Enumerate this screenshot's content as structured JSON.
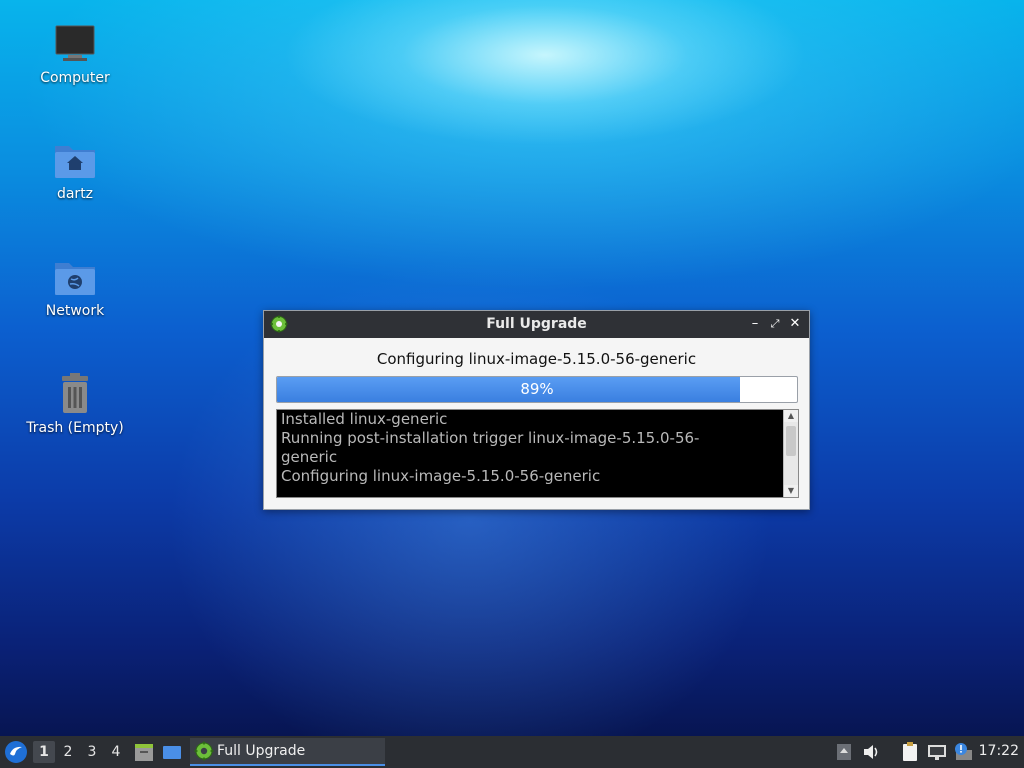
{
  "desktop": {
    "icons": [
      {
        "label": "Computer",
        "icon": "computer-icon"
      },
      {
        "label": "dartz",
        "icon": "home-folder-icon"
      },
      {
        "label": "Network",
        "icon": "network-folder-icon"
      },
      {
        "label": "Trash (Empty)",
        "icon": "trash-icon"
      }
    ]
  },
  "dialog": {
    "title": "Full Upgrade",
    "status": "Configuring linux-image-5.15.0-56-generic",
    "progress": {
      "value": 0.89,
      "label": "89%"
    },
    "log_lines": [
      "Installed linux-generic",
      "Running post-installation trigger linux-image-5.15.0-56-\ngeneric",
      "Configuring linux-image-5.15.0-56-generic"
    ],
    "buttons": {
      "minimize": "minimize-icon",
      "maximize": "maximize-icon",
      "close": "close-icon"
    }
  },
  "taskbar": {
    "workspaces": [
      "1",
      "2",
      "3",
      "4"
    ],
    "active_workspace": "1",
    "task": {
      "label": "Full Upgrade"
    },
    "clock": "17:22"
  },
  "colors": {
    "accent": "#4a8fe7",
    "panel": "#2b2e33",
    "titlebar": "#2f3136"
  }
}
